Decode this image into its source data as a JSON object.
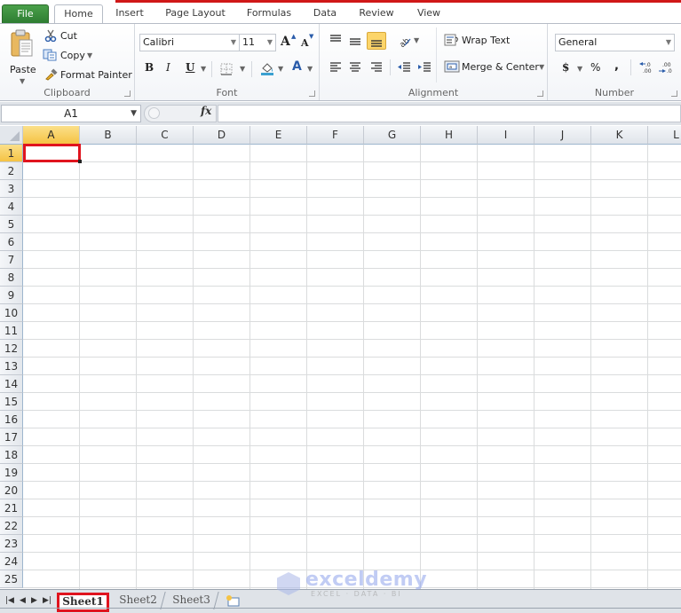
{
  "ribbon_tabs": [
    {
      "label": "File"
    },
    {
      "label": "Home"
    },
    {
      "label": "Insert"
    },
    {
      "label": "Page Layout"
    },
    {
      "label": "Formulas"
    },
    {
      "label": "Data"
    },
    {
      "label": "Review"
    },
    {
      "label": "View"
    }
  ],
  "clipboard": {
    "group_label": "Clipboard",
    "paste": "Paste",
    "cut": "Cut",
    "copy": "Copy",
    "format_painter": "Format Painter"
  },
  "font": {
    "group_label": "Font",
    "font_name": "Calibri",
    "font_size": "11",
    "bold": "B",
    "italic": "I",
    "underline": "U",
    "font_color_glyph": "A",
    "grow_glyph": "A",
    "shrink_glyph": "A"
  },
  "alignment": {
    "group_label": "Alignment",
    "wrap_text": "Wrap Text",
    "merge_center": "Merge & Center",
    "bottom_align_active": true
  },
  "number": {
    "group_label": "Number",
    "format": "General",
    "currency": "$",
    "percent": "%",
    "comma": ",",
    "increase_decimal": "+.0",
    "decrease_decimal": ".00"
  },
  "formula_bar": {
    "name_box": "A1",
    "fx": "fx",
    "formula": ""
  },
  "grid": {
    "columns": [
      "A",
      "B",
      "C",
      "D",
      "E",
      "F",
      "G",
      "H",
      "I",
      "J",
      "K",
      "L"
    ],
    "rows": [
      "1",
      "2",
      "3",
      "4",
      "5",
      "6",
      "7",
      "8",
      "9",
      "10",
      "11",
      "12",
      "13",
      "14",
      "15",
      "16",
      "17",
      "18",
      "19",
      "20",
      "21",
      "22",
      "23",
      "24",
      "25"
    ],
    "selected_cell": "A1",
    "selected_column": "A",
    "selected_row": "1"
  },
  "sheets": [
    {
      "label": "Sheet1",
      "active": true
    },
    {
      "label": "Sheet2",
      "active": false
    },
    {
      "label": "Sheet3",
      "active": false
    }
  ],
  "watermark": {
    "title": "exceldemy",
    "subtitle": "EXCEL · DATA · BI"
  },
  "colors": {
    "file_tab": "#2e7d32",
    "highlight": "#e0141e",
    "selected_header": "#f5c344"
  }
}
